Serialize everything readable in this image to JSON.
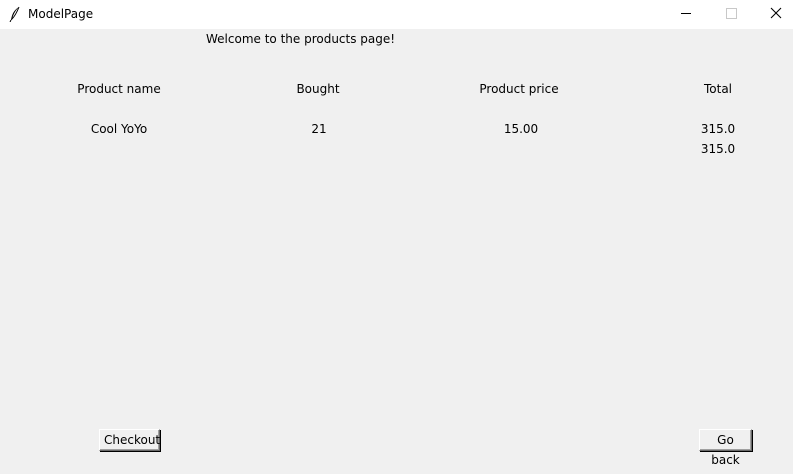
{
  "window": {
    "title": "ModelPage",
    "icon": "feather-icon",
    "controls": [
      "minimize-icon",
      "maximize-icon",
      "close-icon"
    ]
  },
  "page": {
    "welcome": "Welcome to the products page!"
  },
  "table": {
    "headers": {
      "name": "Product name",
      "bought": "Bought",
      "price": "Product price",
      "total": "Total"
    },
    "rows": [
      {
        "name": "Cool YoYo",
        "bought": "21",
        "price": "15.00",
        "total": "315.0"
      }
    ],
    "grand_total": "315.0"
  },
  "buttons": {
    "checkout": "Checkout",
    "go_back": "Go back"
  }
}
